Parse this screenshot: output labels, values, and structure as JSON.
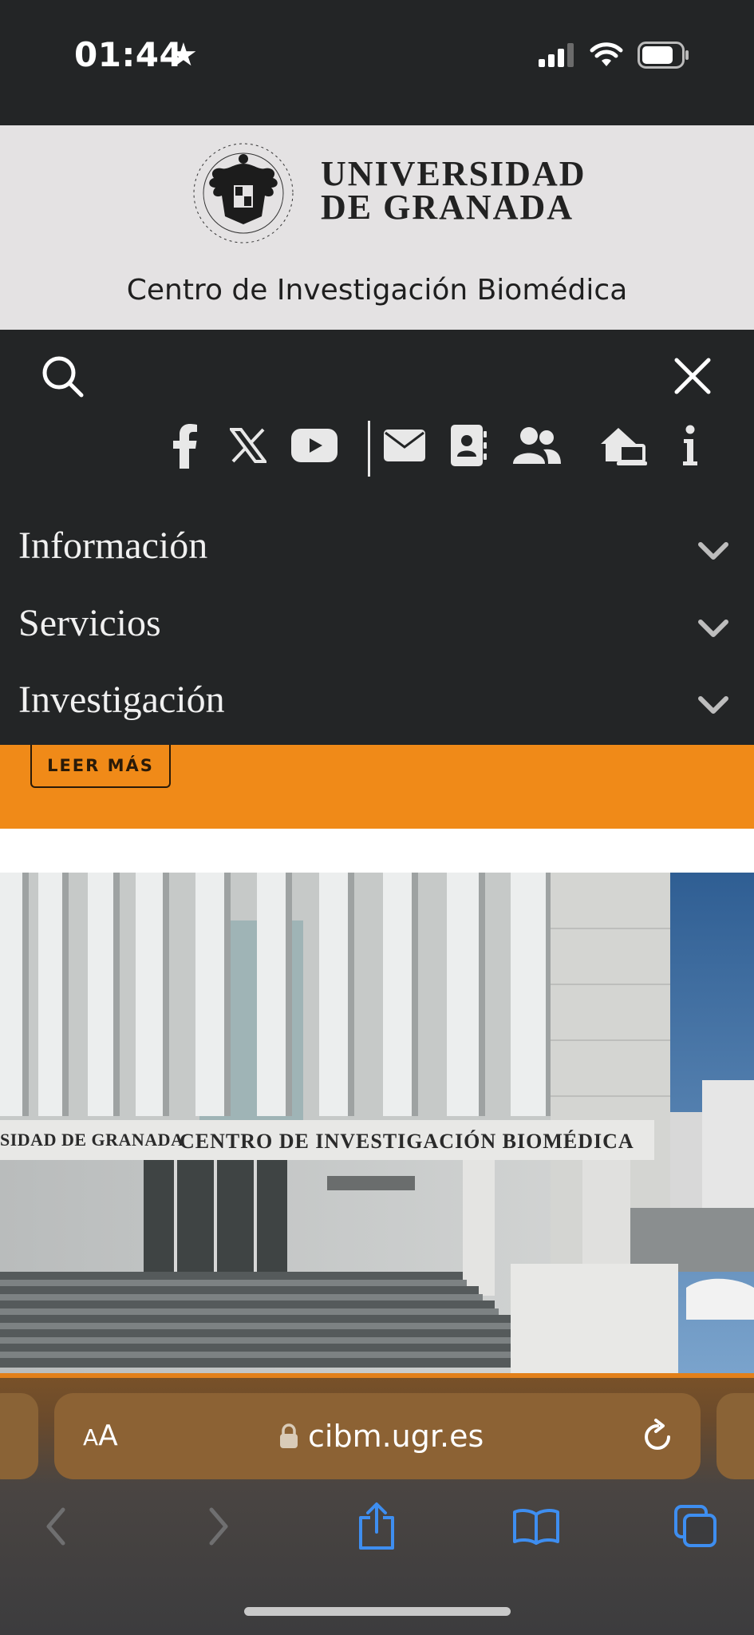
{
  "status": {
    "time": "01:44",
    "star": "★"
  },
  "header": {
    "logo_lines": [
      "UNIVERSIDAD",
      "DE GRANADA"
    ],
    "center_name": "Centro de Investigación Biomédica"
  },
  "menu": {
    "social_icons": [
      "facebook-icon",
      "x-icon",
      "youtube-icon",
      "mail-icon",
      "contact-card-icon",
      "people-icon",
      "home-laptop-icon",
      "info-icon"
    ],
    "items": [
      {
        "label": "Información"
      },
      {
        "label": "Servicios"
      },
      {
        "label": "Investigación"
      }
    ]
  },
  "banner": {
    "leer_mas": "LEER MÁS"
  },
  "image": {
    "sign_left": "SIDAD DE GRANADA",
    "sign_right": "CENTRO DE INVESTIGACIÓN BIOMÉDICA"
  },
  "browser": {
    "aa_small": "A",
    "aa_big": "A",
    "url": "cibm.ugr.es"
  },
  "colors": {
    "accent_orange": "#f08a18",
    "dark": "#232526",
    "header_bg": "#e4e2e3"
  }
}
